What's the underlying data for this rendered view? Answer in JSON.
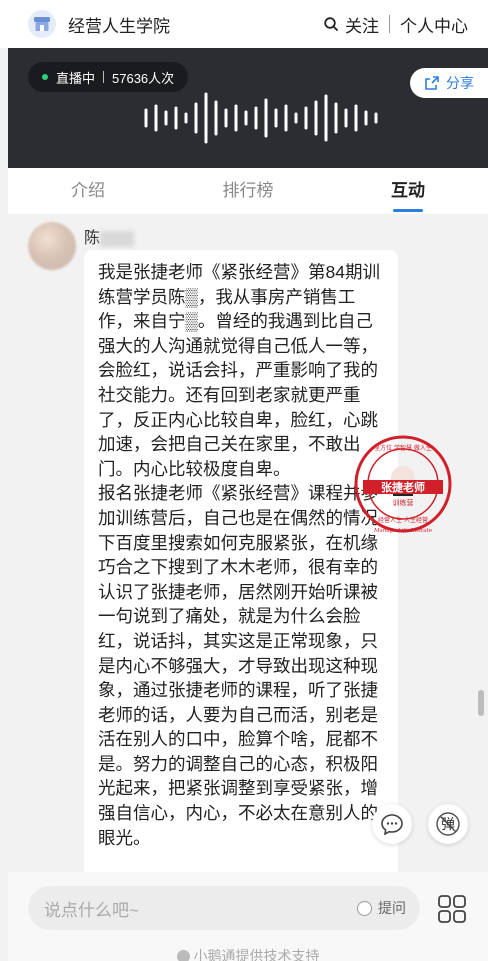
{
  "header": {
    "school_name": "经营人生学院",
    "follow_label": "关注",
    "profile_label": "个人中心"
  },
  "live": {
    "status_label": "直播中",
    "views": "57636人次",
    "share_label": "分享"
  },
  "tabs": [
    {
      "label": "介绍",
      "active": false
    },
    {
      "label": "排行榜",
      "active": false
    },
    {
      "label": "互动",
      "active": true
    }
  ],
  "message": {
    "author": "陈",
    "paragraphs": [
      "我是张捷老师《紧张经营》第84期训练营学员陈▒，我从事房产销售工作，来自宁▒。曾经的我遇到比自己强大的人沟通就觉得自己低人一等，会脸红，说话会抖，严重影响了我的社交能力。还有回到老家就更严重了，反正内心比较自卑，脸红，心跳加速，会把自己关在家里，不敢出门。内心比较极度自卑。",
      "报名张捷老师《紧张经营》课程并参加训练营后，自己也是在偶然的情况下百度里搜索如何克服紧张，在机缘巧合之下搜到了木木老师，很有幸的认识了张捷老师，居然刚开始听课被一句说到了痛处，就是为什么会脸红，说话抖，其实这是正常现象，只是内心不够强大，才导致出现这种现象，通过张捷老师的课程，听了张捷老师的话，人要为自己而活，别老是活在别人的口中，脸算个啥，屁都不是。努力的调整自己的心态，积极阳光起来，把紧张调整到享受紧张，增强自信心，内心，不必太在意别人的眼光。"
    ]
  },
  "stamp": {
    "top_text": "全方位 · 学智慧 · 做人生",
    "center_name": "张捷老师",
    "center_sub": "训练营",
    "bottom_text": "经营人生 · 人生经营",
    "english": "Manage Life Insitute"
  },
  "float_buttons": {
    "comment_icon": "chat-bubble-icon",
    "barrage_label": "弹"
  },
  "composer": {
    "placeholder": "说点什么吧~",
    "ask_label": "提问"
  },
  "footer": {
    "powered_by": "小鹅通提供技术支持"
  },
  "colors": {
    "accent": "#2f7de1",
    "live_bg": "#2b2d33",
    "live_dot": "#2ed07b",
    "stamp_red": "#d0202a"
  }
}
